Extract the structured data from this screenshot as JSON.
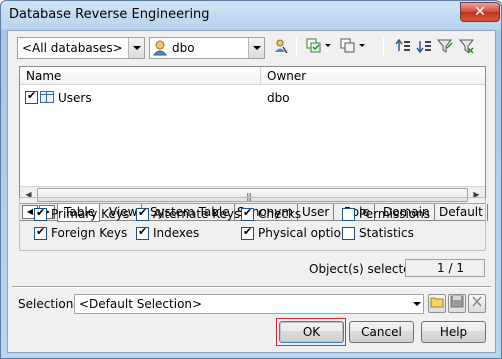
{
  "window": {
    "title": "Database Reverse Engineering",
    "close_glyph": "✕"
  },
  "toolbar": {
    "database_combo": "<All databases>",
    "owner_combo": "dbo",
    "icons": [
      "owner-filter-icon",
      "select-all-icon",
      "deselect-all-icon",
      "move-up-icon",
      "move-down-icon",
      "filter-icon",
      "clear-filter-icon"
    ]
  },
  "grid": {
    "columns": [
      "Name",
      "Owner"
    ],
    "rows": [
      {
        "checked": true,
        "name": "Users",
        "owner": "dbo"
      }
    ],
    "scroll_grip": "|||"
  },
  "tabs": [
    "Table",
    "View",
    "System Table",
    "Synonym",
    "User",
    "Role",
    "Domain",
    "Default"
  ],
  "options": [
    {
      "label": "Primary Keys",
      "checked": true
    },
    {
      "label": "Alternate Keys",
      "checked": true
    },
    {
      "label": "Checks",
      "checked": true
    },
    {
      "label": "Permissions",
      "checked": false
    },
    {
      "label": "Foreign Keys",
      "checked": true
    },
    {
      "label": "Indexes",
      "checked": true
    },
    {
      "label": "Physical options",
      "checked": true
    },
    {
      "label": "Statistics",
      "checked": false
    }
  ],
  "status": {
    "label": "Object(s) selected:",
    "value": "1 / 1"
  },
  "selection": {
    "label": "Selection:",
    "value": "<Default Selection>"
  },
  "buttons": {
    "ok": "OK",
    "cancel": "Cancel",
    "help": "Help"
  },
  "colors": {
    "title_gradient": "#b9d4ee",
    "ok_highlight": "#d32f2f"
  }
}
